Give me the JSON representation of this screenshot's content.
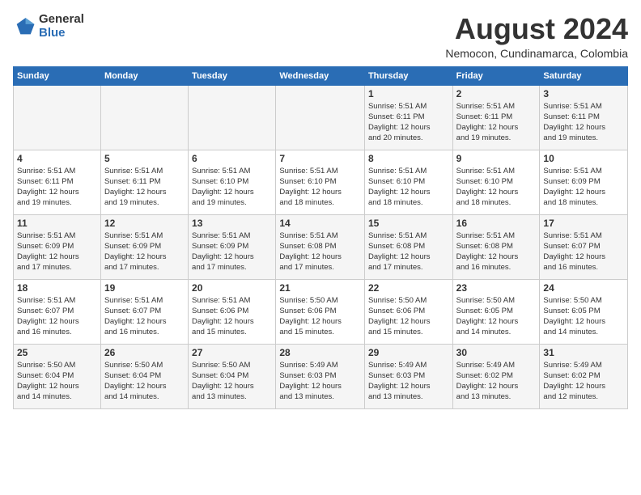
{
  "logo": {
    "general": "General",
    "blue": "Blue"
  },
  "title": "August 2024",
  "location": "Nemocon, Cundinamarca, Colombia",
  "weekdays": [
    "Sunday",
    "Monday",
    "Tuesday",
    "Wednesday",
    "Thursday",
    "Friday",
    "Saturday"
  ],
  "weeks": [
    [
      {
        "day": "",
        "info": ""
      },
      {
        "day": "",
        "info": ""
      },
      {
        "day": "",
        "info": ""
      },
      {
        "day": "",
        "info": ""
      },
      {
        "day": "1",
        "info": "Sunrise: 5:51 AM\nSunset: 6:11 PM\nDaylight: 12 hours\nand 20 minutes."
      },
      {
        "day": "2",
        "info": "Sunrise: 5:51 AM\nSunset: 6:11 PM\nDaylight: 12 hours\nand 19 minutes."
      },
      {
        "day": "3",
        "info": "Sunrise: 5:51 AM\nSunset: 6:11 PM\nDaylight: 12 hours\nand 19 minutes."
      }
    ],
    [
      {
        "day": "4",
        "info": "Sunrise: 5:51 AM\nSunset: 6:11 PM\nDaylight: 12 hours\nand 19 minutes."
      },
      {
        "day": "5",
        "info": "Sunrise: 5:51 AM\nSunset: 6:11 PM\nDaylight: 12 hours\nand 19 minutes."
      },
      {
        "day": "6",
        "info": "Sunrise: 5:51 AM\nSunset: 6:10 PM\nDaylight: 12 hours\nand 19 minutes."
      },
      {
        "day": "7",
        "info": "Sunrise: 5:51 AM\nSunset: 6:10 PM\nDaylight: 12 hours\nand 18 minutes."
      },
      {
        "day": "8",
        "info": "Sunrise: 5:51 AM\nSunset: 6:10 PM\nDaylight: 12 hours\nand 18 minutes."
      },
      {
        "day": "9",
        "info": "Sunrise: 5:51 AM\nSunset: 6:10 PM\nDaylight: 12 hours\nand 18 minutes."
      },
      {
        "day": "10",
        "info": "Sunrise: 5:51 AM\nSunset: 6:09 PM\nDaylight: 12 hours\nand 18 minutes."
      }
    ],
    [
      {
        "day": "11",
        "info": "Sunrise: 5:51 AM\nSunset: 6:09 PM\nDaylight: 12 hours\nand 17 minutes."
      },
      {
        "day": "12",
        "info": "Sunrise: 5:51 AM\nSunset: 6:09 PM\nDaylight: 12 hours\nand 17 minutes."
      },
      {
        "day": "13",
        "info": "Sunrise: 5:51 AM\nSunset: 6:09 PM\nDaylight: 12 hours\nand 17 minutes."
      },
      {
        "day": "14",
        "info": "Sunrise: 5:51 AM\nSunset: 6:08 PM\nDaylight: 12 hours\nand 17 minutes."
      },
      {
        "day": "15",
        "info": "Sunrise: 5:51 AM\nSunset: 6:08 PM\nDaylight: 12 hours\nand 17 minutes."
      },
      {
        "day": "16",
        "info": "Sunrise: 5:51 AM\nSunset: 6:08 PM\nDaylight: 12 hours\nand 16 minutes."
      },
      {
        "day": "17",
        "info": "Sunrise: 5:51 AM\nSunset: 6:07 PM\nDaylight: 12 hours\nand 16 minutes."
      }
    ],
    [
      {
        "day": "18",
        "info": "Sunrise: 5:51 AM\nSunset: 6:07 PM\nDaylight: 12 hours\nand 16 minutes."
      },
      {
        "day": "19",
        "info": "Sunrise: 5:51 AM\nSunset: 6:07 PM\nDaylight: 12 hours\nand 16 minutes."
      },
      {
        "day": "20",
        "info": "Sunrise: 5:51 AM\nSunset: 6:06 PM\nDaylight: 12 hours\nand 15 minutes."
      },
      {
        "day": "21",
        "info": "Sunrise: 5:50 AM\nSunset: 6:06 PM\nDaylight: 12 hours\nand 15 minutes."
      },
      {
        "day": "22",
        "info": "Sunrise: 5:50 AM\nSunset: 6:06 PM\nDaylight: 12 hours\nand 15 minutes."
      },
      {
        "day": "23",
        "info": "Sunrise: 5:50 AM\nSunset: 6:05 PM\nDaylight: 12 hours\nand 14 minutes."
      },
      {
        "day": "24",
        "info": "Sunrise: 5:50 AM\nSunset: 6:05 PM\nDaylight: 12 hours\nand 14 minutes."
      }
    ],
    [
      {
        "day": "25",
        "info": "Sunrise: 5:50 AM\nSunset: 6:04 PM\nDaylight: 12 hours\nand 14 minutes."
      },
      {
        "day": "26",
        "info": "Sunrise: 5:50 AM\nSunset: 6:04 PM\nDaylight: 12 hours\nand 14 minutes."
      },
      {
        "day": "27",
        "info": "Sunrise: 5:50 AM\nSunset: 6:04 PM\nDaylight: 12 hours\nand 13 minutes."
      },
      {
        "day": "28",
        "info": "Sunrise: 5:49 AM\nSunset: 6:03 PM\nDaylight: 12 hours\nand 13 minutes."
      },
      {
        "day": "29",
        "info": "Sunrise: 5:49 AM\nSunset: 6:03 PM\nDaylight: 12 hours\nand 13 minutes."
      },
      {
        "day": "30",
        "info": "Sunrise: 5:49 AM\nSunset: 6:02 PM\nDaylight: 12 hours\nand 13 minutes."
      },
      {
        "day": "31",
        "info": "Sunrise: 5:49 AM\nSunset: 6:02 PM\nDaylight: 12 hours\nand 12 minutes."
      }
    ]
  ]
}
